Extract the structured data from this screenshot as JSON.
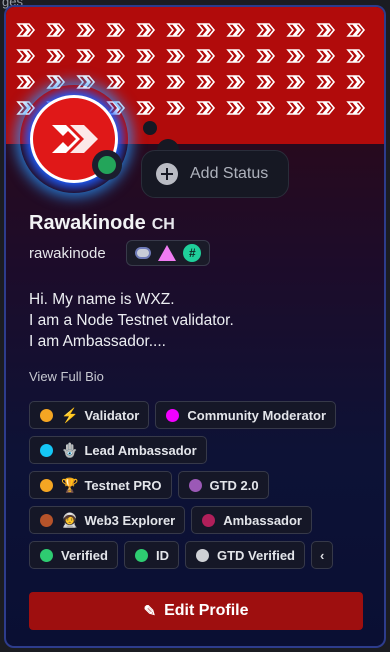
{
  "background_text": "ges",
  "profile": {
    "display_name": "Rawakinode",
    "display_tag": "CH",
    "username": "rawakinode",
    "status_online": true,
    "add_status_label": "Add Status",
    "badges": [
      "nitro-boost-badge",
      "triangle-badge",
      "hashtag-badge"
    ],
    "bio_lines": [
      "Hi. My name is WXZ.",
      "I am a Node Testnet validator.",
      "I am Ambassador...."
    ],
    "view_full_bio_label": "View Full Bio",
    "edit_profile_label": "Edit Profile"
  },
  "roles": [
    [
      {
        "label": "Validator",
        "dot": "#f5a623",
        "emoji": "⚡"
      },
      {
        "label": "Community Moderator",
        "dot": "#f200ff",
        "emoji": ""
      }
    ],
    [
      {
        "label": "Lead Ambassador",
        "dot": "#15c6f6",
        "emoji": "🪬"
      }
    ],
    [
      {
        "label": "Testnet PRO",
        "dot": "#f5a623",
        "emoji": "🏆"
      },
      {
        "label": "GTD 2.0",
        "dot": "#9b59b6",
        "emoji": ""
      }
    ],
    [
      {
        "label": "Web3 Explorer",
        "dot": "#b5532a",
        "emoji": "🧑‍🚀"
      },
      {
        "label": "Ambassador",
        "dot": "#b01f5a",
        "emoji": ""
      }
    ],
    [
      {
        "label": "Verified",
        "dot": "#2ecc71",
        "emoji": ""
      },
      {
        "label": "ID",
        "dot": "#2ecc71",
        "emoji": ""
      },
      {
        "label": "GTD Verified",
        "dot": "#cfd1d6",
        "emoji": ""
      }
    ]
  ],
  "more_roles_label": "‹",
  "colors": {
    "banner": "#b10b0b",
    "avatar": "#e01818",
    "button": "#9e0f0f",
    "online": "#23a55a"
  }
}
